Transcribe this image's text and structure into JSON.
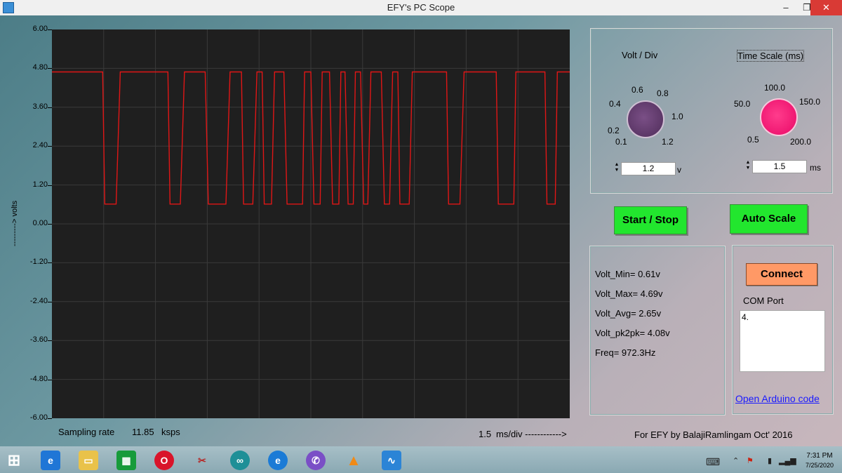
{
  "window": {
    "title": "EFY's PC Scope",
    "min": "–",
    "max": "❐",
    "close": "✕"
  },
  "y_axis": {
    "label": "---------> volts",
    "ticks": [
      "6.00",
      "4.80",
      "3.60",
      "2.40",
      "1.20",
      "0.00",
      "-1.20",
      "-2.40",
      "-3.60",
      "-4.80",
      "-6.00"
    ]
  },
  "chart_data": {
    "type": "line",
    "ylabel": "---------> volts",
    "ylim": [
      -6.0,
      6.0
    ],
    "x_range": [
      0,
      100
    ],
    "grid": true,
    "series": [
      {
        "color": "#e01616",
        "x": [
          0,
          9.8,
          10.2,
          12.4,
          13.2,
          22.4,
          22.8,
          24.8,
          25.6,
          29.6,
          30.2,
          33.6,
          34.4,
          36.6,
          37.0,
          38.8,
          39.6,
          40.6,
          41.0,
          42.4,
          43.0,
          44.8,
          45.4,
          48.4,
          48.8,
          50.0,
          50.6,
          51.8,
          52.2,
          53.6,
          54.2,
          55.4,
          55.8,
          56.6,
          57.2,
          58.2,
          58.6,
          59.6,
          60.2,
          61.0,
          61.6,
          63.6,
          64.2,
          65.2,
          65.8,
          66.8,
          67.2,
          69.0,
          69.6,
          76.2,
          76.6,
          78.8,
          79.6,
          85.8,
          86.2,
          89.2,
          89.6,
          95.2,
          95.6,
          97.2,
          97.6,
          100
        ],
        "y": [
          4.69,
          4.69,
          0.61,
          0.61,
          4.69,
          4.69,
          0.61,
          0.61,
          4.69,
          4.69,
          0.61,
          0.61,
          4.69,
          4.69,
          0.61,
          0.61,
          4.69,
          4.69,
          0.61,
          0.61,
          4.69,
          4.69,
          0.61,
          0.61,
          4.69,
          4.69,
          0.61,
          0.61,
          4.69,
          4.69,
          0.61,
          0.61,
          4.69,
          4.69,
          0.61,
          0.61,
          4.69,
          4.69,
          0.61,
          0.61,
          4.69,
          4.69,
          0.61,
          0.61,
          4.69,
          4.69,
          0.61,
          0.61,
          4.69,
          4.69,
          0.61,
          0.61,
          4.69,
          4.69,
          0.61,
          0.61,
          4.69,
          4.69,
          0.61,
          0.61,
          4.69,
          4.69
        ]
      }
    ]
  },
  "footer": {
    "sampling_label": "Sampling rate",
    "sampling_value": "11.85",
    "sampling_unit": "ksps",
    "div_value": "1.5",
    "div_unit": "ms/div ------------>"
  },
  "controls": {
    "volt_div": {
      "label": "Volt / Div",
      "ticks": [
        "0.1",
        "0.2",
        "0.4",
        "0.6",
        "0.8",
        "1.0",
        "1.2"
      ],
      "value": "1.2",
      "unit": "v"
    },
    "time_scale": {
      "label": "Time Scale (ms)",
      "ticks": [
        "0.5",
        "50.0",
        "100.0",
        "150.0",
        "200.0"
      ],
      "value": "1.5",
      "unit": "ms"
    },
    "start_stop": "Start / Stop",
    "auto_scale": "Auto Scale"
  },
  "stats": {
    "min": "Volt_Min= 0.61v",
    "max": "Volt_Max= 4.69v",
    "avg": "Volt_Avg= 2.65v",
    "pk2pk": "Volt_pk2pk= 4.08v",
    "freq": "Freq= 972.3Hz"
  },
  "com": {
    "connect": "Connect",
    "port_label": "COM Port",
    "ports": [
      "4."
    ],
    "link": "Open Arduino code"
  },
  "credit": "For EFY by BalajiRamlingam Oct' 2016",
  "taskbar": {
    "time": "7:31 PM",
    "date": "7/25/2020"
  }
}
